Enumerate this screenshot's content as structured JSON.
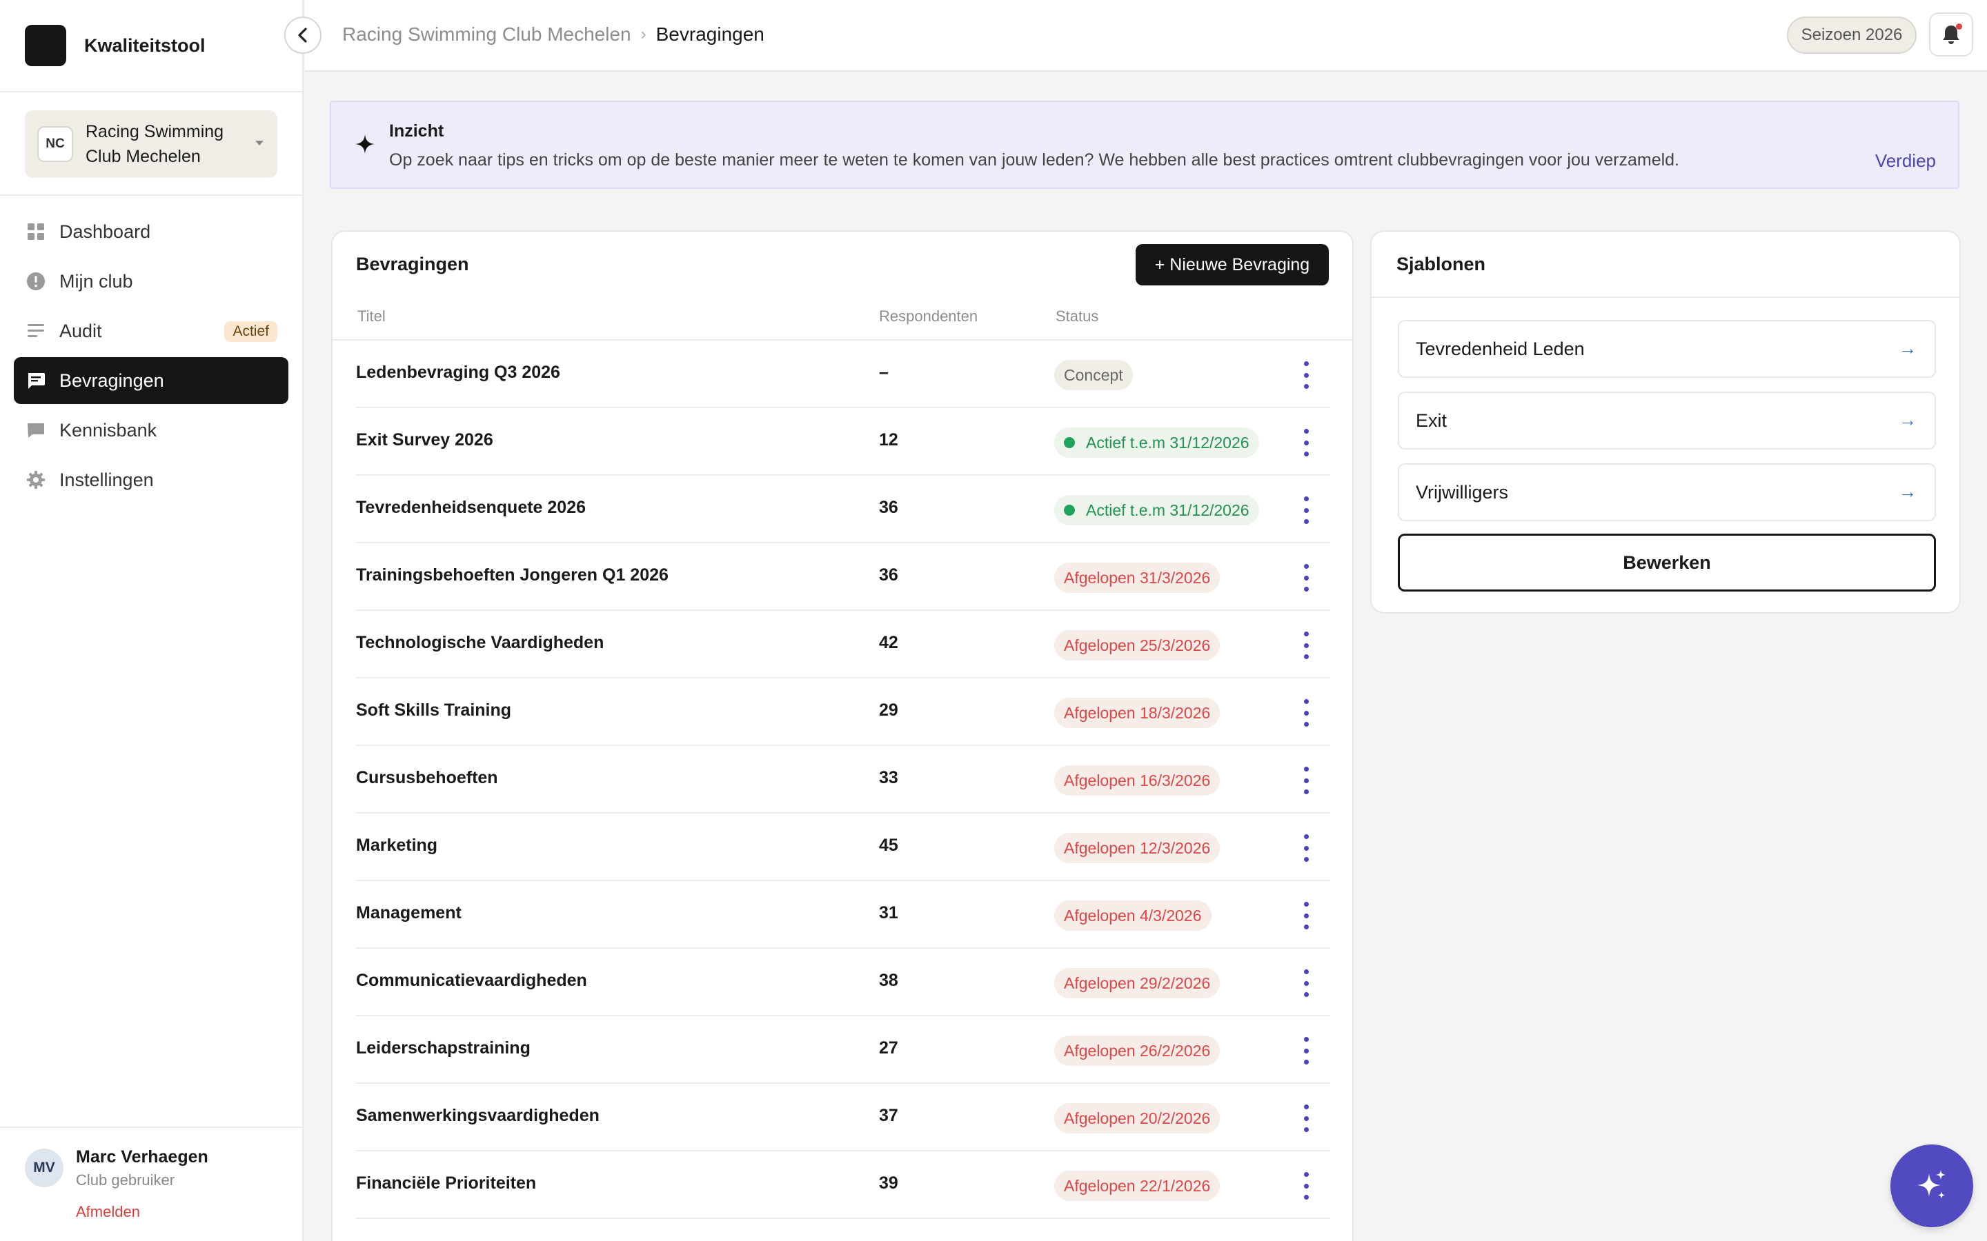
{
  "app": {
    "name": "Kwaliteitstool"
  },
  "club": {
    "initials": "NC",
    "name": "Racing Swimming Club Mechelen"
  },
  "nav": [
    {
      "label": "Dashboard",
      "icon": "dashboard-icon"
    },
    {
      "label": "Mijn club",
      "icon": "info-icon"
    },
    {
      "label": "Audit",
      "icon": "audit-icon",
      "badge": "Actief"
    },
    {
      "label": "Bevragingen",
      "icon": "chat-icon",
      "active": true
    },
    {
      "label": "Kennisbank",
      "icon": "book-icon"
    },
    {
      "label": "Instellingen",
      "icon": "gear-icon"
    }
  ],
  "user": {
    "initials": "MV",
    "name": "Marc Verhaegen",
    "role": "Club gebruiker",
    "logout": "Afmelden"
  },
  "header": {
    "breadcrumb_parent": "Racing Swimming Club Mechelen",
    "breadcrumb_sep": "›",
    "breadcrumb_current": "Bevragingen",
    "season": "Seizoen 2026"
  },
  "insight": {
    "title": "Inzicht",
    "text": "Op zoek naar tips en tricks om op de beste manier meer te weten te komen van jouw leden? We hebben alle best practices omtrent clubbevragingen voor jou verzameld.",
    "link": "Verdiep"
  },
  "surveys": {
    "title": "Bevragingen",
    "new_button": "+ Nieuwe Bevraging",
    "columns": {
      "title": "Titel",
      "respondents": "Respondenten",
      "status": "Status"
    },
    "rows": [
      {
        "title": "Ledenbevraging Q3 2026",
        "respondents": "–",
        "status": "Concept",
        "kind": "concept"
      },
      {
        "title": "Exit Survey 2026",
        "respondents": "12",
        "status": "Actief t.e.m 31/12/2026",
        "kind": "actief"
      },
      {
        "title": "Tevredenheidsenquete 2026",
        "respondents": "36",
        "status": "Actief t.e.m 31/12/2026",
        "kind": "actief"
      },
      {
        "title": "Trainingsbehoeften Jongeren Q1 2026",
        "respondents": "36",
        "status": "Afgelopen 31/3/2026",
        "kind": "afgelopen"
      },
      {
        "title": "Technologische Vaardigheden",
        "respondents": "42",
        "status": "Afgelopen 25/3/2026",
        "kind": "afgelopen"
      },
      {
        "title": "Soft Skills Training",
        "respondents": "29",
        "status": "Afgelopen 18/3/2026",
        "kind": "afgelopen"
      },
      {
        "title": "Cursusbehoeften",
        "respondents": "33",
        "status": "Afgelopen 16/3/2026",
        "kind": "afgelopen"
      },
      {
        "title": "Marketing",
        "respondents": "45",
        "status": "Afgelopen 12/3/2026",
        "kind": "afgelopen"
      },
      {
        "title": "Management",
        "respondents": "31",
        "status": "Afgelopen 4/3/2026",
        "kind": "afgelopen"
      },
      {
        "title": "Communicatievaardigheden",
        "respondents": "38",
        "status": "Afgelopen 29/2/2026",
        "kind": "afgelopen"
      },
      {
        "title": "Leiderschapstraining",
        "respondents": "27",
        "status": "Afgelopen 26/2/2026",
        "kind": "afgelopen"
      },
      {
        "title": "Samenwerkingsvaardigheden",
        "respondents": "37",
        "status": "Afgelopen 20/2/2026",
        "kind": "afgelopen"
      },
      {
        "title": "Financiële Prioriteiten",
        "respondents": "39",
        "status": "Afgelopen 22/1/2026",
        "kind": "afgelopen"
      }
    ]
  },
  "templates": {
    "title": "Sjablonen",
    "items": [
      {
        "label": "Tevredenheid Leden",
        "arrow": "→"
      },
      {
        "label": "Exit",
        "arrow": "→"
      },
      {
        "label": "Vrijwilligers",
        "arrow": "→"
      }
    ],
    "edit_button": "Bewerken"
  },
  "colors": {
    "accent": "#514ac1",
    "active_nav": "#161616",
    "status_active": "#219152",
    "status_ended": "#dd4747",
    "insight_bg": "#eeebfb"
  }
}
